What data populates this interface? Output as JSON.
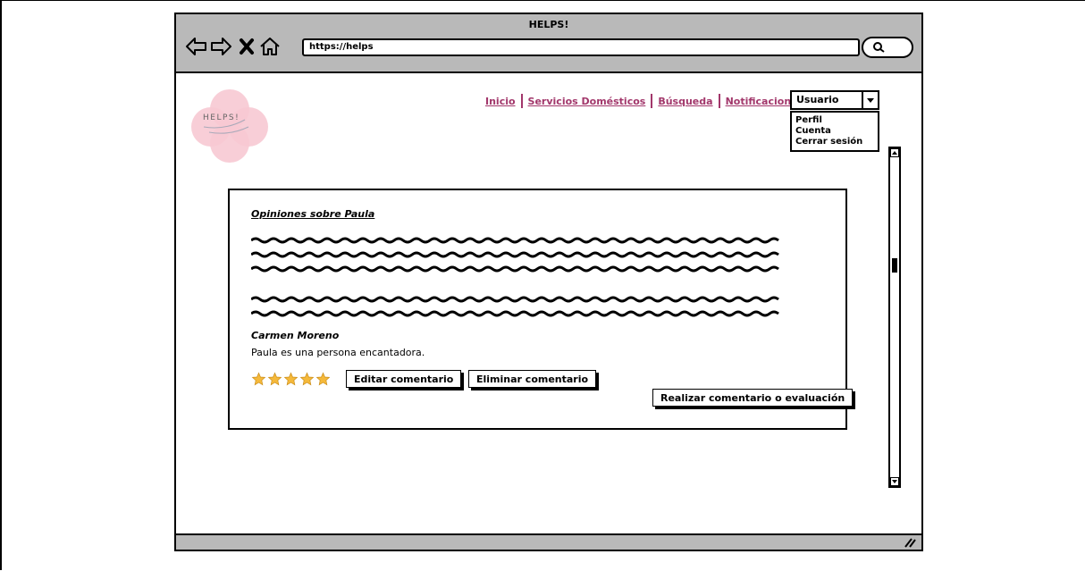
{
  "browser": {
    "title": "HELPS!",
    "url": "https://helps"
  },
  "logo": {
    "text": "HELPS!"
  },
  "nav": {
    "items": [
      "Inicio",
      "Servicios Domésticos",
      "Búsqueda",
      "Notificaciones"
    ]
  },
  "user_menu": {
    "selected": "Usuario",
    "options": [
      "Perfil",
      "Cuenta",
      "Cerrar sesión"
    ]
  },
  "opinions": {
    "heading": "Opiniones sobre Paula",
    "comment": {
      "author": "Carmen Moreno",
      "text": "Paula es una persona encantadora.",
      "rating": 5,
      "rating_max": 5
    },
    "edit_label": "Editar comentario",
    "delete_label": "Eliminar comentario",
    "add_label": "Realizar comentario o evaluación"
  },
  "colors": {
    "nav_link": "#a2376b",
    "chrome": "#b9b9b9",
    "logo_pink": "#f7c9d3",
    "star": "#f5b93b"
  }
}
